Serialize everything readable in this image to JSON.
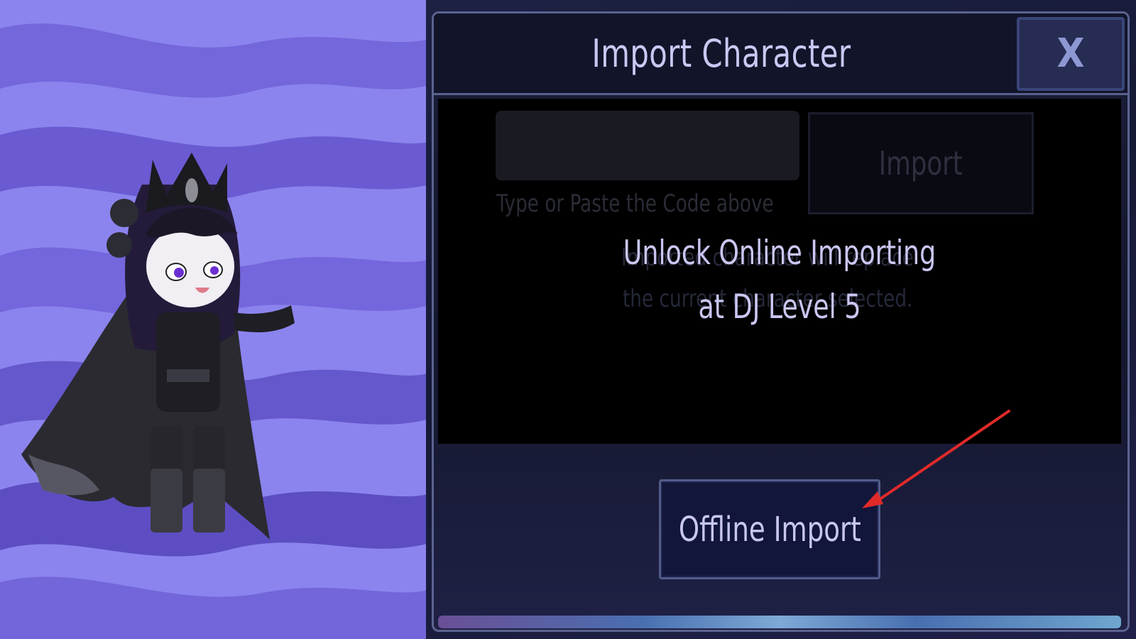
{
  "dialog": {
    "title": "Import Character",
    "close_label": "X"
  },
  "import_panel": {
    "code_input_value": "",
    "code_hint": "Type or Paste the Code above",
    "import_button_label": "Import",
    "dimmed_line_1": "Imported character will replace",
    "dimmed_line_2": "the current character selected."
  },
  "lock_message": {
    "line_1": "Unlock Online Importing",
    "line_2": "at DJ Level 5"
  },
  "offline_button_label": "Offline Import",
  "colors": {
    "background_purple": "#8b84ee",
    "wave_purple": "#6c5ed1",
    "dialog_dark": "#14172e",
    "text_light": "#c9c7f1",
    "annotation_red": "#e02a2a"
  },
  "icons": {
    "close": "close-icon",
    "annotation": "red-arrow-icon"
  }
}
